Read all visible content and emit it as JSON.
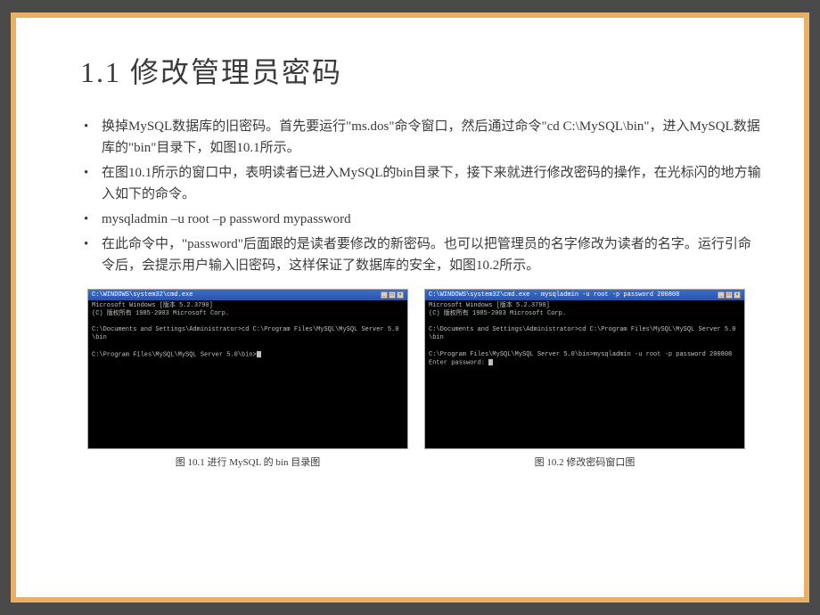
{
  "title": "1.1  修改管理员密码",
  "bullets": [
    "换掉MySQL数据库的旧密码。首先要运行\"ms.dos\"命令窗口，然后通过命令\"cd C:\\MySQL\\bin\"，进入MySQL数据库的\"bin\"目录下，如图10.1所示。",
    "在图10.1所示的窗口中，表明读者已进入MySQL的bin目录下，接下来就进行修改密码的操作，在光标闪的地方输入如下的命令。",
    "mysqladmin –u root –p password mypassword",
    "在此命令中，\"password\"后面跟的是读者要修改的新密码。也可以把管理员的名字修改为读者的名字。运行引命令后，会提示用户输入旧密码，这样保证了数据库的安全，如图10.2所示。"
  ],
  "terminals": [
    {
      "titlebar": "C:\\WINDOWS\\system32\\cmd.exe",
      "lines": [
        "Microsoft Windows [版本 5.2.3790]",
        "(C) 版权所有 1985-2003 Microsoft Corp.",
        "",
        "C:\\Documents and Settings\\Administrator>cd C:\\Program Files\\MySQL\\MySQL Server 5.0\\bin",
        "",
        "C:\\Program Files\\MySQL\\MySQL Server 5.0\\bin>"
      ],
      "caption": "图 10.1  进行 MySQL 的 bin 目录图"
    },
    {
      "titlebar": "C:\\WINDOWS\\system32\\cmd.exe - mysqladmin -u root -p password 200808",
      "lines": [
        "Microsoft Windows [版本 5.2.3790]",
        "(C) 版权所有 1985-2003 Microsoft Corp.",
        "",
        "C:\\Documents and Settings\\Administrator>cd C:\\Program Files\\MySQL\\MySQL Server 5.0\\bin",
        "",
        "C:\\Program Files\\MySQL\\MySQL Server 5.0\\bin>mysqladmin -u root -p password 200808",
        "Enter password:"
      ],
      "caption": "图 10.2  修改密码窗口图"
    }
  ],
  "window_buttons": [
    "_",
    "□",
    "×"
  ]
}
